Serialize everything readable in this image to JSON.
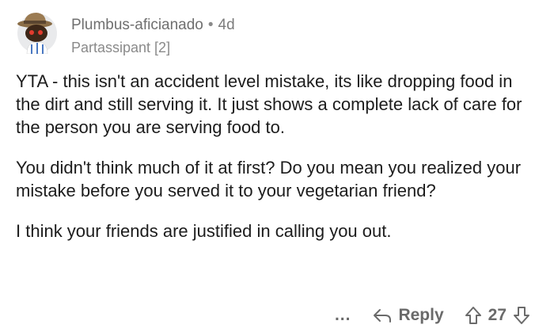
{
  "comment": {
    "username": "Plumbus-aficianado",
    "separator": "•",
    "age": "4d",
    "flair": "Partassipant [2]",
    "paragraphs": [
      "YTA - this isn't an accident level mistake, its like dropping food in the dirt and still serving it.   It just shows a complete lack of care for the person you are serving food to.",
      "You didn't think much of it at first?   Do you mean you realized your mistake before you served it to your vegetarian friend?",
      "I think your friends are justified in calling you out."
    ],
    "actions": {
      "more_label": "...",
      "reply_label": "Reply",
      "vote_count": "27"
    }
  },
  "icons": {
    "avatar": "snoo-avatar-icon",
    "more": "more-options-icon",
    "reply": "reply-arrow-icon",
    "upvote": "upvote-arrow-icon",
    "downvote": "downvote-arrow-icon"
  }
}
